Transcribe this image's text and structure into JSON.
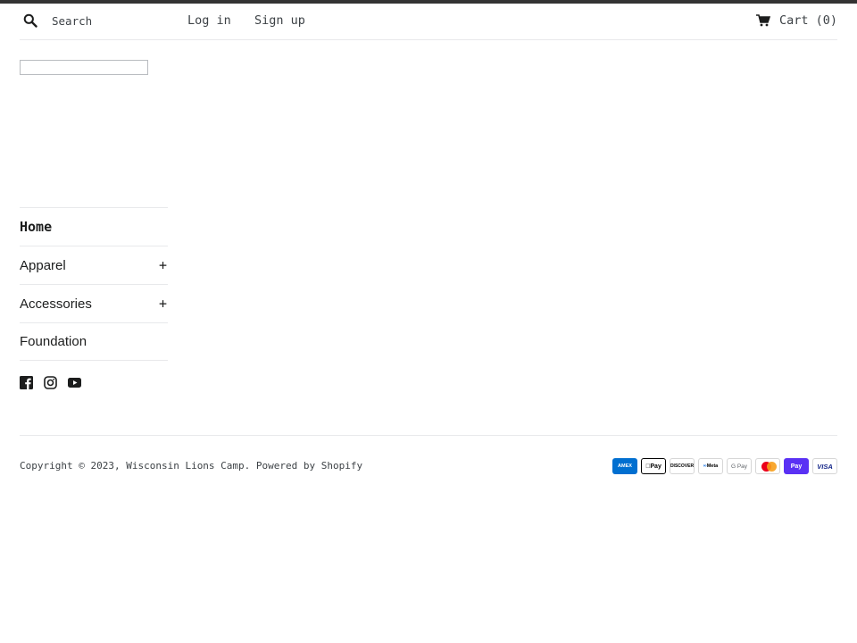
{
  "header": {
    "search_placeholder": "Search",
    "login": "Log in",
    "signup": "Sign up",
    "cart": "Cart (0)"
  },
  "sidenav": {
    "items": [
      {
        "label": "Home",
        "expandable": false
      },
      {
        "label": "Apparel",
        "expandable": true,
        "toggle": "+"
      },
      {
        "label": "Accessories",
        "expandable": true,
        "toggle": "+"
      },
      {
        "label": "Foundation",
        "expandable": false
      }
    ]
  },
  "social": [
    "facebook-icon",
    "instagram-icon",
    "youtube-icon"
  ],
  "footer": {
    "copyright_prefix": "Copyright © 2023, ",
    "store_name": "Wisconsin Lions Camp",
    "separator": ". ",
    "powered_by": "Powered by Shopify"
  },
  "payments": {
    "amex": "AMEX",
    "apple_pay": "Pay",
    "discover": "DISCOVER",
    "meta_pay": "Meta",
    "google_pay": "G Pay",
    "shop_pay": "Pay",
    "visa": "VISA"
  },
  "colors": {
    "topbar": "#333333",
    "text": "#3d4246",
    "border": "#e8e9eb"
  }
}
